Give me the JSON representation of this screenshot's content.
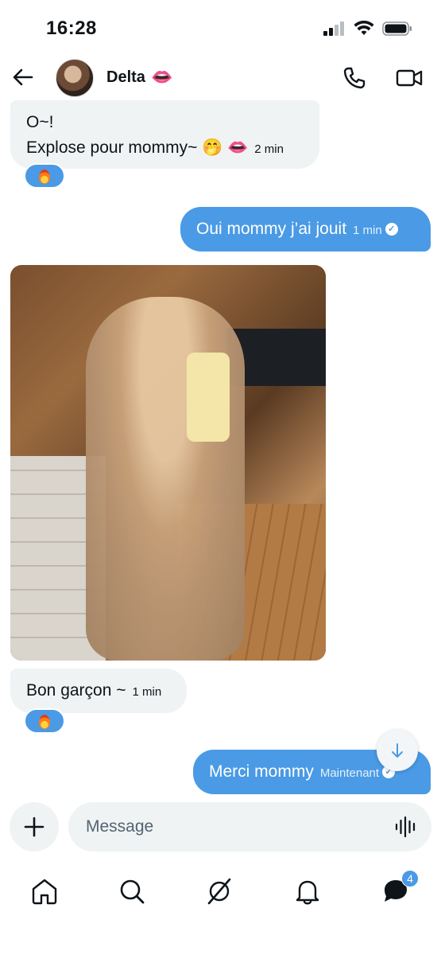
{
  "status_bar": {
    "time": "16:28"
  },
  "header": {
    "contact_name": "Delta",
    "contact_emoji": "👄"
  },
  "messages": [
    {
      "direction": "in",
      "lines": [
        "O~!",
        "Explose pour mommy~ 🤭 👄"
      ],
      "time": "2 min",
      "reaction": "🔥"
    },
    {
      "direction": "out",
      "text": "Oui mommy j’ai jouit",
      "time": "1 min",
      "read": true
    },
    {
      "direction": "in",
      "type": "image"
    },
    {
      "direction": "in",
      "text": "Bon garçon ~",
      "time": "1 min",
      "reaction": "🔥"
    },
    {
      "direction": "out",
      "text": "Merci mommy",
      "time": "Maintenant",
      "read": true
    }
  ],
  "composer": {
    "placeholder": "Message"
  },
  "bottom_nav": {
    "items": [
      "home-icon",
      "search-icon",
      "grok-icon",
      "notifications-icon",
      "messages-icon"
    ],
    "messages_badge": "4"
  },
  "colors": {
    "accent": "#4a9ae5",
    "incoming_bubble": "#eff3f4",
    "text": "#0f1419"
  }
}
